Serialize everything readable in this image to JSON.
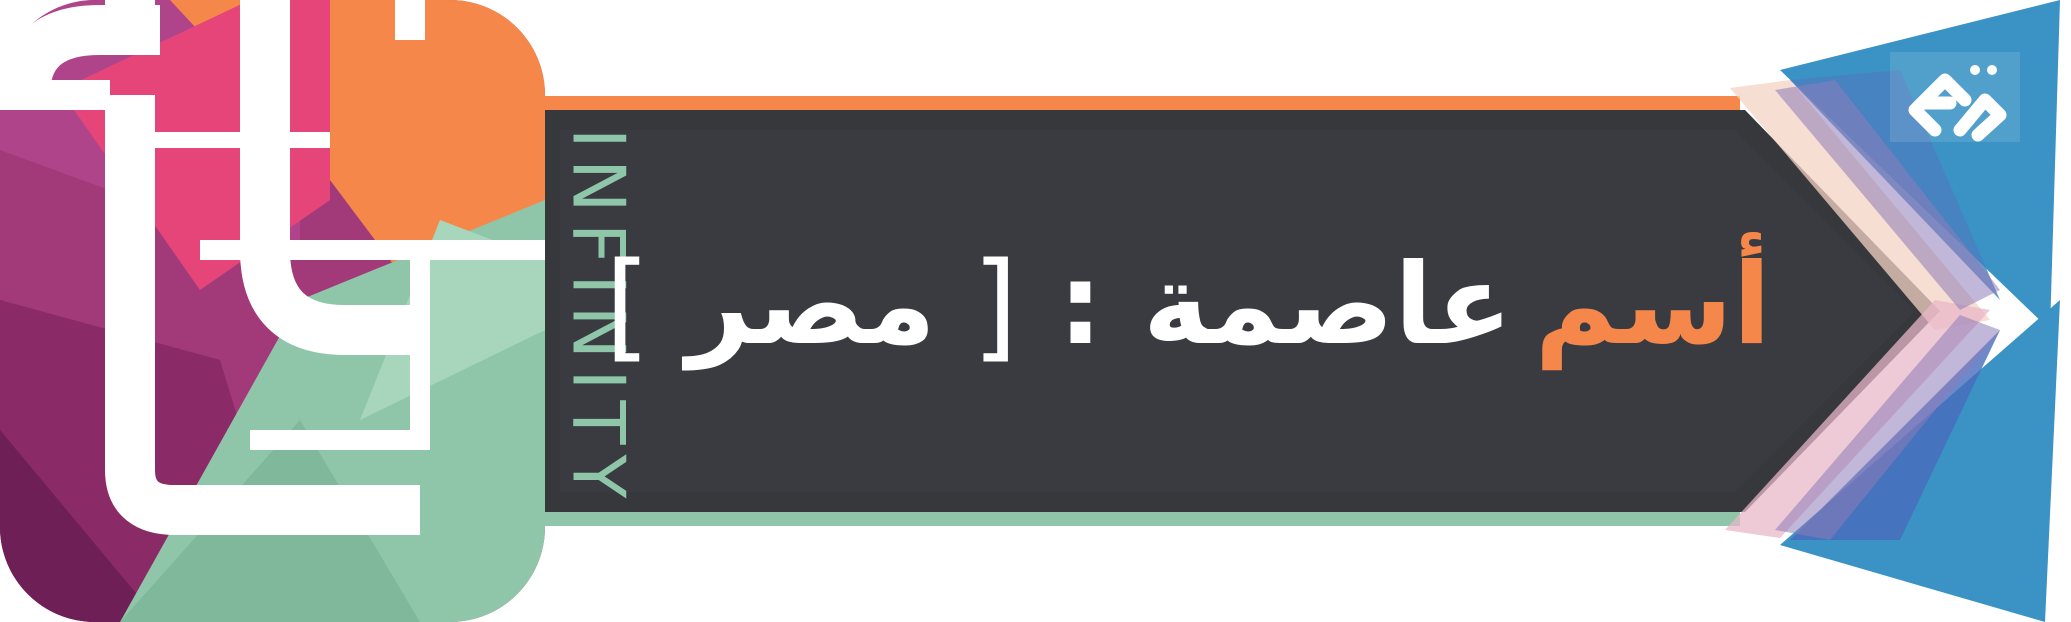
{
  "logo": {
    "icon": "it-infinity-logo",
    "word": "INFINITY"
  },
  "title": {
    "prefix": "أسم",
    "subject": "عاصمة",
    "colon": ":",
    "bracket_open": "[",
    "answer": "مصر",
    "bracket_close": "]"
  },
  "corner_logo": {
    "icon": "corner-mark-icon"
  },
  "colors": {
    "orange": "#f5874a",
    "green": "#8fc6a9",
    "magenta": "#a23a7a",
    "pink": "#e6457a",
    "dark": "#37383c",
    "blue": "#3a93c4",
    "white": "#ffffff"
  }
}
